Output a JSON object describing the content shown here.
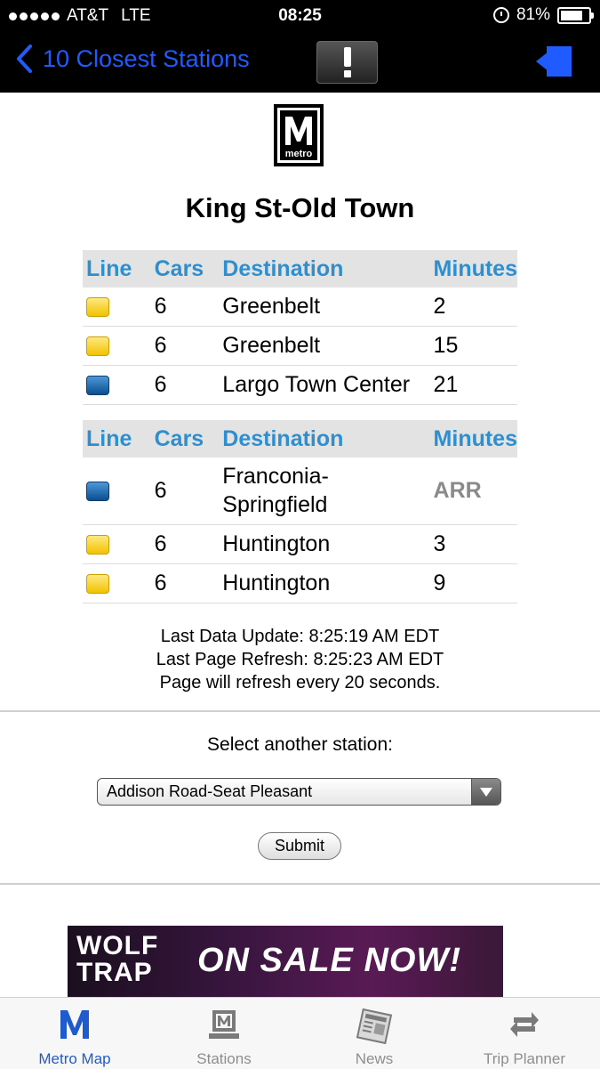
{
  "status_bar": {
    "carrier": "AT&T",
    "network": "LTE",
    "time": "08:25",
    "battery": "81%"
  },
  "nav": {
    "back_label": "10 Closest Stations"
  },
  "logo_text": "metro",
  "station": {
    "name": "King St-Old Town"
  },
  "headers": {
    "line": "Line",
    "cars": "Cars",
    "destination": "Destination",
    "minutes": "Minutes"
  },
  "platform1": [
    {
      "line_color": "yellow",
      "cars": "6",
      "destination": "Greenbelt",
      "minutes": "2"
    },
    {
      "line_color": "yellow",
      "cars": "6",
      "destination": "Greenbelt",
      "minutes": "15"
    },
    {
      "line_color": "blue",
      "cars": "6",
      "destination": "Largo Town Center",
      "minutes": "21"
    }
  ],
  "platform2": [
    {
      "line_color": "blue",
      "cars": "6",
      "destination_line1": "Franconia-",
      "destination_line2": "Springfield",
      "minutes": "ARR"
    },
    {
      "line_color": "yellow",
      "cars": "6",
      "destination": "Huntington",
      "minutes": "3"
    },
    {
      "line_color": "yellow",
      "cars": "6",
      "destination": "Huntington",
      "minutes": "9"
    }
  ],
  "updates": {
    "data_update": "Last Data Update: 8:25:19 AM EDT",
    "page_refresh": "Last Page Refresh: 8:25:23 AM EDT",
    "refresh_note": "Page will refresh every 20 seconds."
  },
  "selector": {
    "label": "Select another station:",
    "selected": "Addison Road-Seat Pleasant",
    "submit": "Submit"
  },
  "ad": {
    "logo_line1": "WOLF",
    "logo_line2": "TRAP",
    "tagline": "ON SALE NOW!"
  },
  "tabs": [
    {
      "label": "Metro Map"
    },
    {
      "label": "Stations"
    },
    {
      "label": "News"
    },
    {
      "label": "Trip Planner"
    }
  ],
  "colors": {
    "accent": "#1f5bff",
    "header_text": "#2e8fd0",
    "yellow_line": "#f2c200",
    "blue_line": "#0b4f8f"
  }
}
